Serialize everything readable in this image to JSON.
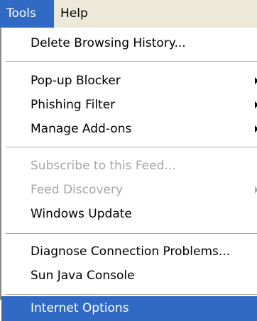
{
  "menubar": {
    "tools_label": "Tools",
    "help_label": "Help"
  },
  "menu": {
    "delete_history": "Delete Browsing History...",
    "popup_blocker": "Pop-up Blocker",
    "phishing_filter": "Phishing Filter",
    "manage_addons": "Manage Add-ons",
    "subscribe_feed": "Subscribe to this Feed...",
    "feed_discovery": "Feed Discovery",
    "windows_update": "Windows Update",
    "diagnose_connection": "Diagnose Connection Problems...",
    "sun_java_console": "Sun Java Console",
    "internet_options": "Internet Options"
  },
  "colors": {
    "highlight": "#316ac5",
    "disabled_text": "#a7a6aa",
    "menubar_bg": "#ece9d8"
  }
}
